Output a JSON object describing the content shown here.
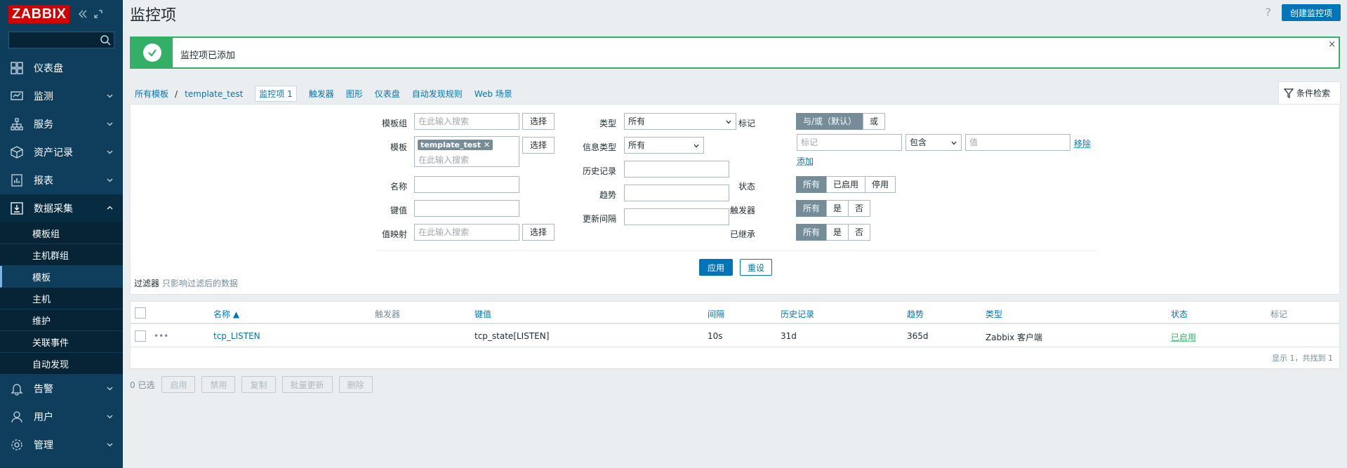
{
  "sidebar": {
    "logo": "ZABBIX",
    "search_placeholder": "",
    "items": [
      {
        "label": "仪表盘",
        "icon": "dashboard-icon"
      },
      {
        "label": "监测",
        "icon": "monitoring-icon"
      },
      {
        "label": "服务",
        "icon": "services-icon"
      },
      {
        "label": "资产记录",
        "icon": "inventory-icon"
      },
      {
        "label": "报表",
        "icon": "reports-icon"
      },
      {
        "label": "数据采集",
        "icon": "data-collection-icon"
      },
      {
        "label": "告警",
        "icon": "alerts-icon"
      },
      {
        "label": "用户",
        "icon": "users-icon"
      },
      {
        "label": "管理",
        "icon": "administration-icon"
      }
    ],
    "subitems": [
      "模板组",
      "主机群组",
      "模板",
      "主机",
      "维护",
      "关联事件",
      "自动发现"
    ],
    "active_sub": "模板"
  },
  "header": {
    "title": "监控项",
    "help": "?",
    "create_label": "创建监控项"
  },
  "message": {
    "text": "监控项已添加",
    "close": "×"
  },
  "breadcrumb": {
    "all_templates": "所有模板",
    "sep": "/",
    "template": "template_test",
    "items_tab": "监控项 1",
    "triggers": "触发器",
    "graphs": "图形",
    "dashboards": "仪表盘",
    "discovery": "自动发现规则",
    "web": "Web 场景"
  },
  "filter_tab_label": "条件检索",
  "filter": {
    "template_group_label": "模板组",
    "template_group_placeholder": "在此输入搜索",
    "select_label": "选择",
    "template_label": "模板",
    "template_chip": "template_test ✕",
    "template_placeholder": "在此输入搜索",
    "name_label": "名称",
    "key_label": "键值",
    "valuemap_label": "值映射",
    "valuemap_placeholder": "在此输入搜索",
    "type_label": "类型",
    "type_value": "所有",
    "info_type_label": "信息类型",
    "info_type_value": "所有",
    "history_label": "历史记录",
    "trends_label": "趋势",
    "interval_label": "更新间隔",
    "tags_label": "标记",
    "tags_mode": [
      "与/或（默认）",
      "或"
    ],
    "tag_placeholder": "标记",
    "tag_op": "包含",
    "value_placeholder": "值",
    "remove_label": "移除",
    "add_label": "添加",
    "state_label": "状态",
    "state_options": [
      "所有",
      "已启用",
      "停用"
    ],
    "triggers_label": "触发器",
    "triggers_options": [
      "所有",
      "是",
      "否"
    ],
    "inherited_label": "已继承",
    "inherited_options": [
      "所有",
      "是",
      "否"
    ],
    "apply": "应用",
    "reset": "重设",
    "caption": "过滤器",
    "caption_hint": "只影响过滤后的数据"
  },
  "table": {
    "headers": {
      "name": "名称 ▲",
      "triggers": "触发器",
      "key": "键值",
      "interval": "间隔",
      "history": "历史记录",
      "trends": "趋势",
      "type": "类型",
      "status": "状态",
      "tags": "标记"
    },
    "rows": [
      {
        "menu": "•••",
        "name": "tcp_LISTEN",
        "triggers": "",
        "key": "tcp_state[LISTEN]",
        "interval": "10s",
        "history": "31d",
        "trends": "365d",
        "type": "Zabbix 客户端",
        "status": "已启用",
        "tags": ""
      }
    ],
    "footer": "显示 1，共找到 1"
  },
  "actions": {
    "count": "0 已选",
    "buttons": [
      "启用",
      "禁用",
      "复制",
      "批量更新",
      "删除"
    ]
  },
  "colors": {
    "sidebar_bg": "#0e3e5c",
    "accent": "#0275b8",
    "success": "#34af67",
    "logo_red": "#d40000"
  }
}
